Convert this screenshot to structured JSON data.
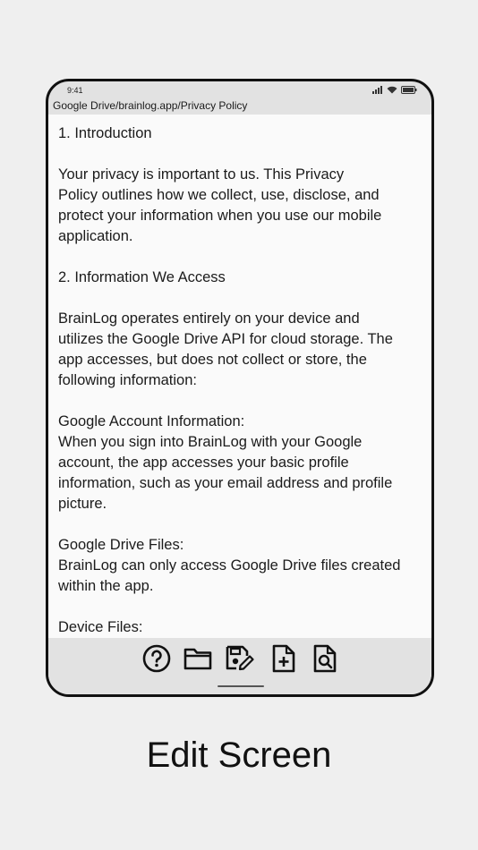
{
  "status_bar": {
    "time": "9:41",
    "icons": [
      "signal-icon",
      "wifi-icon",
      "battery-icon"
    ]
  },
  "path_bar": {
    "path": "Google Drive/brainlog.app/Privacy Policy"
  },
  "document": {
    "text": "1. Introduction\n\nYour privacy is important to us. This Privacy\nPolicy outlines how we collect, use, disclose, and\nprotect your information when you use our mobile\napplication.\n\n2. Information We Access\n\nBrainLog operates entirely on your device and\nutilizes the Google Drive API for cloud storage. The\napp accesses, but does not collect or store, the\nfollowing information:\n\nGoogle Account Information:\nWhen you sign into BrainLog with your Google\naccount, the app accesses your basic profile\ninformation, such as your email address and profile\npicture.\n\nGoogle Drive Files:\nBrainLog can only access Google Drive files created\nwithin the app.\n\nDevice Files:\nWith your consent, the app may access files in\nshared folders on your device."
  },
  "toolbar": {
    "buttons": [
      "help-icon",
      "folder-icon",
      "save-edit-icon",
      "new-file-icon",
      "file-search-icon"
    ]
  },
  "caption": "Edit Screen"
}
